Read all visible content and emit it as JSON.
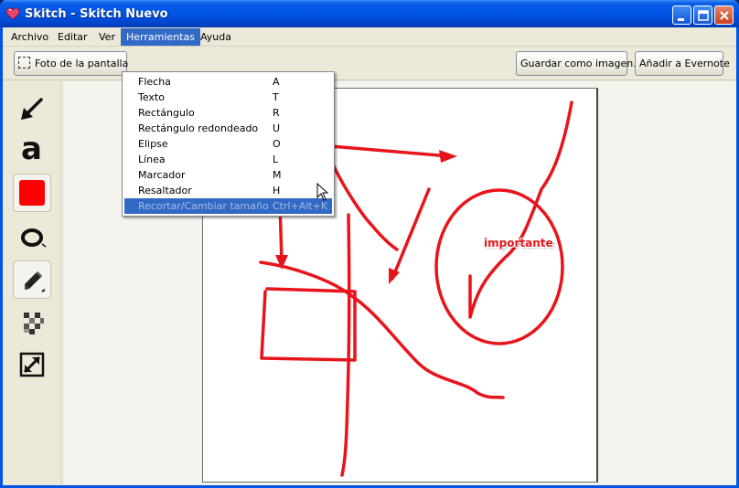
{
  "window": {
    "title": "Skitch - Skitch Nuevo"
  },
  "menubar": {
    "items": [
      "Archivo",
      "Editar",
      "Ver",
      "Herramientas",
      "Ayuda"
    ],
    "active": "Herramientas"
  },
  "toolbar": {
    "snapshot_label": "Foto de la pantalla",
    "save_image_label": "Guardar como imagen...",
    "evernote_label": "Añadir a Evernote"
  },
  "tools_menu": {
    "items": [
      {
        "label": "Flecha",
        "shortcut": "A"
      },
      {
        "label": "Texto",
        "shortcut": "T"
      },
      {
        "label": "Rectángulo",
        "shortcut": "R"
      },
      {
        "label": "Rectángulo redondeado",
        "shortcut": "U"
      },
      {
        "label": "Elipse",
        "shortcut": "O"
      },
      {
        "label": "Línea",
        "shortcut": "L"
      },
      {
        "label": "Marcador",
        "shortcut": "M"
      },
      {
        "label": "Resaltador",
        "shortcut": "H"
      },
      {
        "label": "Recortar/Cambiar tamaño",
        "shortcut": "Ctrl+Alt+K"
      }
    ],
    "highlighted": "Recortar/Cambiar tamaño"
  },
  "palette": {
    "text_tool_glyph": "a",
    "tools": [
      "arrow-tool-icon",
      "text-tool-icon",
      "color-swatch",
      "ellipse-tool-icon",
      "marker-tool-icon",
      "pixelate-tool-icon",
      "resize-tool-icon"
    ],
    "selected_color": "#ff0000"
  },
  "canvas": {
    "annotation_text": "importante",
    "stroke_color": "#e8141c"
  },
  "colors": {
    "titlebar": "#0055e5",
    "menu_highlight": "#316ac5",
    "chrome": "#ece9d8"
  }
}
